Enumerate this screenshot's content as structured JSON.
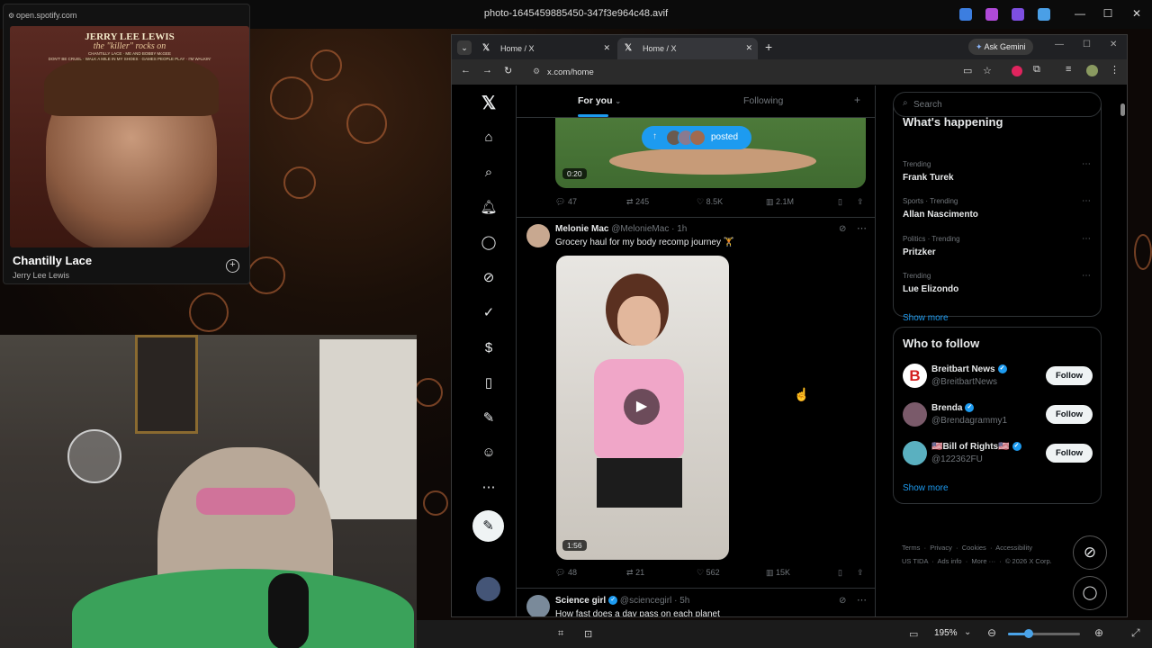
{
  "viewer": {
    "title": "photo-1645459885450-347f3e964c48.avif",
    "zoom": "195%"
  },
  "spotify": {
    "url": "open.spotify.com",
    "album_artist": "JERRY LEE LEWIS",
    "album_subtitle": "the \"killer\" rocks on",
    "album_tracks_1": "CHANTILLY LACE · ME AND BOBBY McGEE",
    "album_tracks_2": "DON'T BE CRUEL · WALK A MILE IN MY SHOES · GAMES PEOPLE PLAY · I'M WALKIN'",
    "song": "Chantilly Lace",
    "artist": "Jerry Lee Lewis"
  },
  "browser": {
    "tabs": [
      {
        "label": "Home / X"
      },
      {
        "label": "Home / X"
      }
    ],
    "ask_gemini": "Ask Gemini",
    "url": "x.com/home"
  },
  "x": {
    "feed_tabs": {
      "for_you": "For you",
      "following": "Following"
    },
    "posted_pill": "posted",
    "tweet1": {
      "duration": "0:20",
      "replies": "47",
      "reposts": "245",
      "likes": "8.5K",
      "views": "2.1M"
    },
    "tweet2": {
      "name": "Melonie Mac",
      "handle": "@MelonieMac",
      "time": "· 1h",
      "text": "Grocery haul for my body recomp journey 🏋",
      "duration": "1:56",
      "replies": "48",
      "reposts": "21",
      "likes": "562",
      "views": "15K"
    },
    "tweet3": {
      "name": "Science girl",
      "handle": "@sciencegirl",
      "time": "· 5h",
      "text": "How fast does a day pass on each planet"
    },
    "search_placeholder": "Search",
    "happening": {
      "title": "What's happening",
      "trends": [
        {
          "context": "Trending",
          "name": "Frank Turek"
        },
        {
          "context": "Sports · Trending",
          "name": "Allan Nascimento"
        },
        {
          "context": "Politics · Trending",
          "name": "Pritzker"
        },
        {
          "context": "Trending",
          "name": "Lue Elizondo"
        }
      ],
      "show_more": "Show more"
    },
    "who_to_follow": {
      "title": "Who to follow",
      "accounts": [
        {
          "name": "Breitbart News",
          "handle": "@BreitbartNews",
          "button": "Follow"
        },
        {
          "name": "Brenda",
          "handle": "@Brendagrammy1",
          "button": "Follow"
        },
        {
          "name": "🇺🇸Bill of Rights🇺🇸",
          "handle": "@122362FU",
          "button": "Follow"
        }
      ],
      "show_more": "Show more"
    },
    "footer": {
      "terms": "Terms",
      "privacy": "Privacy",
      "cookies": "Cookies",
      "accessibility": "Accessibility",
      "us_tida": "US TIDA",
      "ads_info": "Ads info",
      "more": "More ···",
      "copyright": "© 2026 X Corp."
    }
  }
}
